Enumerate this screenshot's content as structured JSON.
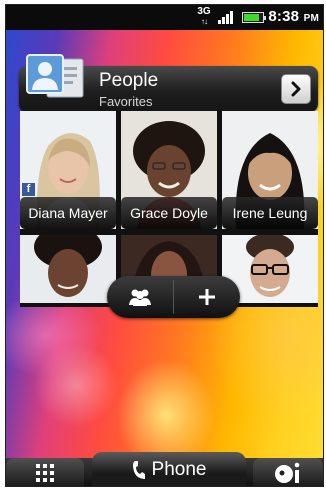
{
  "status_bar": {
    "network_type": "3G",
    "signal_icon": "signal-bars-icon",
    "signal_level": 4,
    "battery_icon": "battery-icon",
    "battery_level": 0.85,
    "time": "8:38",
    "time_suffix": "PM"
  },
  "people_widget": {
    "title": "People",
    "subtitle": "Favorites",
    "header_icon": "contact-card-icon",
    "open_icon": "chevron-right-icon",
    "contacts": [
      {
        "name": "Diana Mayer",
        "facebook_badge": "f",
        "photo_color": "#c9a27c"
      },
      {
        "name": "Grace Doyle",
        "photo_color": "#5a3a28"
      },
      {
        "name": "Irene Leung",
        "photo_color": "#b98c66"
      },
      {
        "name": "",
        "photo_color": "#6b4330"
      },
      {
        "name": "",
        "photo_color": "#7a4a38"
      },
      {
        "name": "",
        "photo_color": "#caa287"
      }
    ],
    "toolbar": {
      "groups_icon": "groups-icon",
      "add_icon": "plus-icon"
    }
  },
  "dock": {
    "all_apps_icon": "grid-icon",
    "phone_icon": "phone-icon",
    "phone_label": "Phone",
    "personalize_icon": "personalize-icon"
  }
}
